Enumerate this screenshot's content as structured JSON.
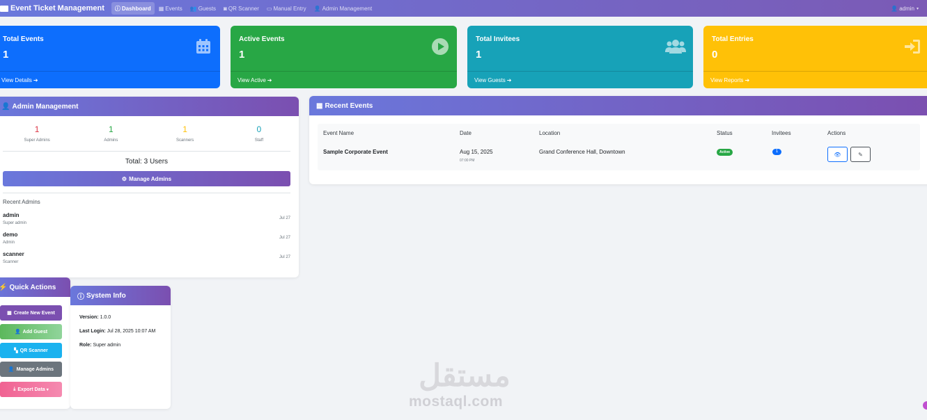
{
  "navbar": {
    "brand": "Event Ticket Management",
    "links": [
      {
        "label": "Dashboard",
        "icon": "info-icon"
      },
      {
        "label": "Events",
        "icon": "calendar-icon"
      },
      {
        "label": "Guests",
        "icon": "users-icon"
      },
      {
        "label": "QR Scanner",
        "icon": "camera-icon"
      },
      {
        "label": "Manual Entry",
        "icon": "keyboard-icon"
      },
      {
        "label": "Admin Management",
        "icon": "user-gear-icon"
      }
    ],
    "user": "admin"
  },
  "stats": [
    {
      "title": "Total Events",
      "value": "1",
      "footer": "View Details",
      "icon": "calendar-icon",
      "color": "#0d6efd"
    },
    {
      "title": "Active Events",
      "value": "1",
      "footer": "View Active",
      "icon": "play-icon",
      "color": "#28a745"
    },
    {
      "title": "Total Invitees",
      "value": "1",
      "footer": "View Guests",
      "icon": "users-icon",
      "color": "#17a2b8"
    },
    {
      "title": "Total Entries",
      "value": "0",
      "footer": "View Reports",
      "icon": "sign-in-icon",
      "color": "#ffc107"
    }
  ],
  "admin_management": {
    "title": "Admin Management",
    "counts": [
      {
        "value": "1",
        "label": "Super Admins",
        "color": "#dc3545"
      },
      {
        "value": "1",
        "label": "Admins",
        "color": "#28a745"
      },
      {
        "value": "1",
        "label": "Scanners",
        "color": "#ffc107"
      },
      {
        "value": "0",
        "label": "Staff",
        "color": "#17a2b8"
      }
    ],
    "total": "Total: 3 Users",
    "manage_button": "Manage Admins",
    "recent_label": "Recent Admins",
    "recent": [
      {
        "name": "admin",
        "role": "Super admin",
        "date": "Jul 27"
      },
      {
        "name": "demo",
        "role": "Admin",
        "date": "Jul 27"
      },
      {
        "name": "scanner",
        "role": "Scanner",
        "date": "Jul 27"
      }
    ]
  },
  "recent_events": {
    "title": "Recent Events",
    "headers": {
      "name": "Event Name",
      "date": "Date",
      "location": "Location",
      "status": "Status",
      "invitees": "Invitees",
      "actions": "Actions"
    },
    "rows": [
      {
        "name": "Sample Corporate Event",
        "date": "Aug 15, 2025",
        "time": "07:00 PM",
        "location": "Grand Conference Hall, Downtown",
        "status": "Active",
        "invitees": "1"
      }
    ]
  },
  "quick_actions": {
    "title": "Quick Actions",
    "buttons": [
      {
        "label": "Create New Event",
        "icon": "calendar-plus-icon",
        "color": "#7b4fb0"
      },
      {
        "label": "Add Guest",
        "icon": "user-plus-icon",
        "color": "#5cb85c"
      },
      {
        "label": "QR Scanner",
        "icon": "qrcode-icon",
        "color": "#1ab2ef"
      },
      {
        "label": "Manage Admins",
        "icon": "user-gear-icon",
        "color": "#6c757d"
      },
      {
        "label": "Export Data",
        "icon": "download-icon",
        "color": "#f0639a"
      }
    ]
  },
  "system_info": {
    "title": "System Info",
    "version_label": "Version:",
    "version": "1.0.0",
    "login_label": "Last Login:",
    "login": "Jul 28, 2025 10:07 AM",
    "role_label": "Role:",
    "role": "Super admin"
  },
  "watermark": {
    "arabic": "مستقل",
    "latin": "mostaql.com"
  }
}
